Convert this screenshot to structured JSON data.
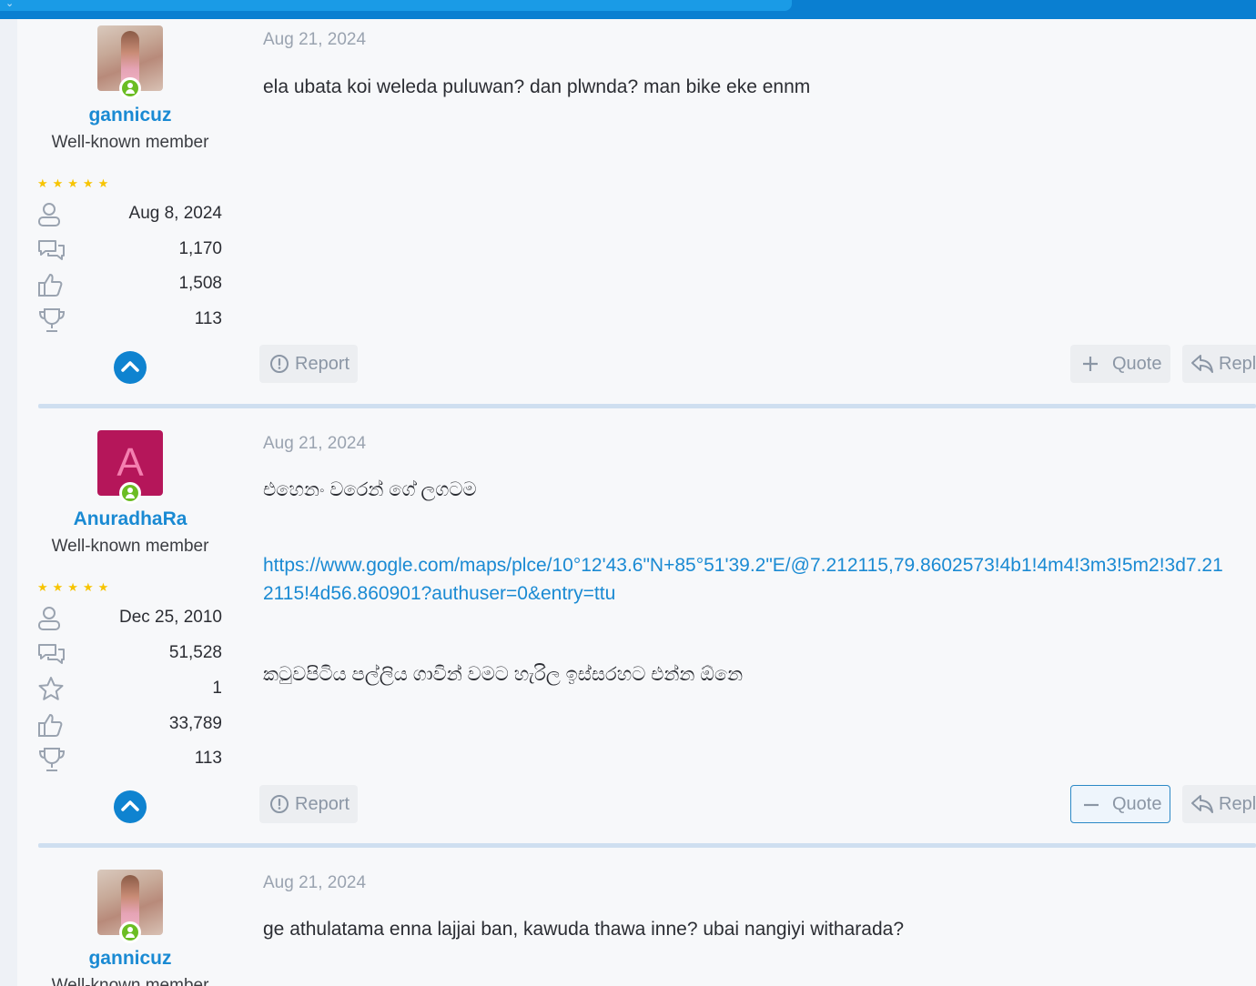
{
  "posts": [
    {
      "date": "Aug 21, 2024",
      "author": {
        "name": "gannicuz",
        "title": "Well-known member",
        "avatar": "photo",
        "online": true
      },
      "rating_stars": "★★★★★",
      "stats": [
        {
          "icon": "user-icon",
          "value": "Aug 8, 2024"
        },
        {
          "icon": "messages-icon",
          "value": "1,170"
        },
        {
          "icon": "thumbs-up-icon",
          "value": "1,508"
        },
        {
          "icon": "trophy-icon",
          "value": "113"
        }
      ],
      "body": [
        "ela ubata koi weleda puluwan? dan plwnda? man bike eke ennm"
      ],
      "actions": {
        "report": "Report",
        "quote": "Quote",
        "reply": "Reply"
      }
    },
    {
      "date": "Aug 21, 2024",
      "author": {
        "name": "AnuradhaRa",
        "title": "Well-known member",
        "avatar_letter": "A",
        "avatar_color": "#b5165a",
        "online": true
      },
      "rating_stars": "★★★★★",
      "stats": [
        {
          "icon": "user-icon",
          "value": "Dec 25, 2010"
        },
        {
          "icon": "messages-icon",
          "value": "51,528"
        },
        {
          "icon": "star-icon",
          "value": "1"
        },
        {
          "icon": "thumbs-up-icon",
          "value": "33,789"
        },
        {
          "icon": "trophy-icon",
          "value": "113"
        }
      ],
      "body": [
        "එහෙනං වරෙන් ගේ ලගටම",
        "https://www.gogle.com/maps/plce/10°12'43.6\"N+85°51'39.2\"E/@7.212115,79.8602573!4b1!4m4!3m3!5m2!3d7.21",
        "2115!4d56.860901?authuser=0&entry=ttu",
        "කටුවපිටිය පල්ලිය ගාවින් වමට හැරිල ඉස්සරහට එන්න ඕනෙ"
      ],
      "actions": {
        "report": "Report",
        "quote": "Quote",
        "reply": "Reply"
      }
    },
    {
      "date": "Aug 21, 2024",
      "author": {
        "name": "gannicuz",
        "title": "Well-known member",
        "avatar": "photo",
        "online": true
      },
      "body": [
        "ge athulatama enna lajjai ban, kawuda thawa inne? ubai nangiyi witharada?"
      ]
    }
  ],
  "colors": {
    "accent": "#1a8ad3",
    "stars": "#f7c400",
    "online": "#6bbd23",
    "topbar": "#0a7fd1"
  }
}
